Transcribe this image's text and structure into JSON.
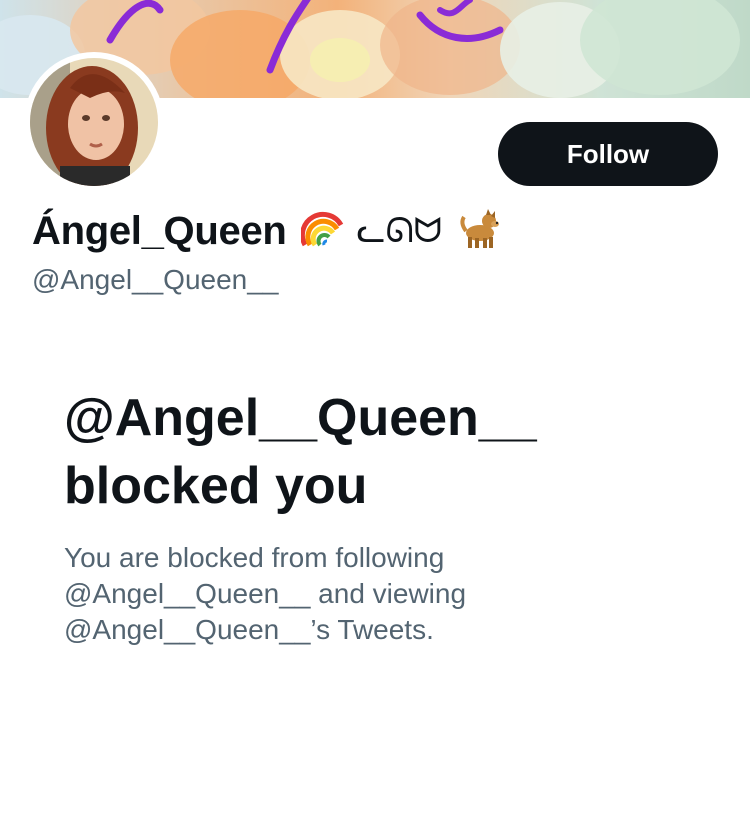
{
  "profile": {
    "display_name": "Ángel_Queen",
    "name_glyphs": "ᓚᘏᗢ",
    "handle": "@Angel__Queen__",
    "name_emoji": [
      "rainbow-emoji",
      "dog-emoji"
    ]
  },
  "actions": {
    "follow_label": "Follow"
  },
  "blocked": {
    "title": "@Angel__Queen__ blocked you",
    "description": "You are blocked from following @Angel__Queen__ and viewing @Angel__Queen__’s Tweets."
  },
  "colors": {
    "button_bg": "#0f1419",
    "text_primary": "#0f1419",
    "text_secondary": "#536471"
  }
}
